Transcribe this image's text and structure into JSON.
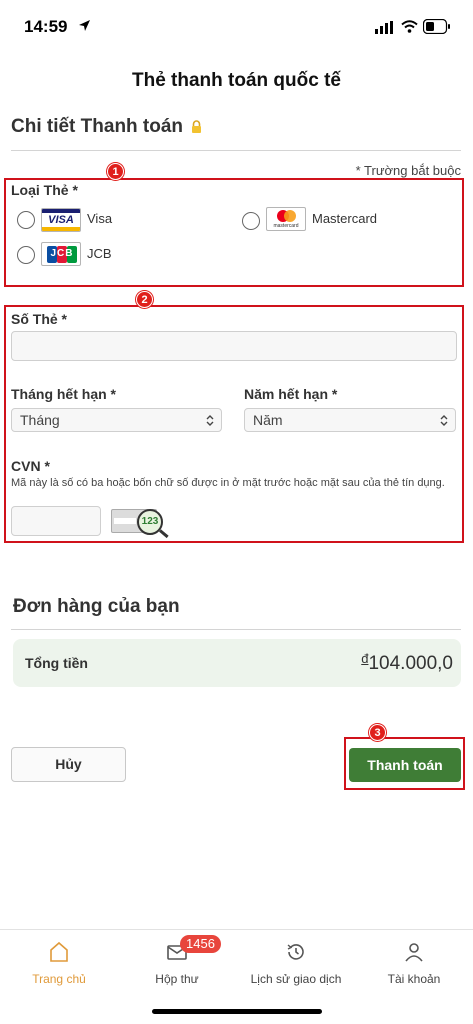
{
  "status_bar": {
    "time": "14:59"
  },
  "header": {
    "title": "Thẻ thanh toán quốc tế"
  },
  "payment": {
    "section_title": "Chi tiết Thanh toán",
    "required_note": "* Trường bắt buộc",
    "card_type_label": "Loại Thẻ *",
    "card_types": [
      {
        "label": "Visa",
        "logo_text": "VISA"
      },
      {
        "label": "Mastercard",
        "logo_text": "mastercard"
      },
      {
        "label": "JCB",
        "logo_text": "JCB"
      }
    ],
    "card_number_label": "Số Thẻ *",
    "card_number_value": "",
    "expiry_month_label": "Tháng hết hạn *",
    "expiry_month_value": "Tháng",
    "expiry_year_label": "Năm hết hạn *",
    "expiry_year_value": "Năm",
    "cvn_label": "CVN *",
    "cvn_help": "Mã này là số có ba hoặc bốn chữ số được in ở mặt trước hoặc mặt sau của thẻ tín dụng.",
    "cvn_value": "",
    "cvn_image_text": "123"
  },
  "annotations": {
    "badge1": "1",
    "badge2": "2",
    "badge3": "3"
  },
  "order": {
    "title": "Đơn hàng của bạn",
    "total_label": "Tổng tiền",
    "currency_symbol": "đ",
    "total_value": "104.000,0"
  },
  "actions": {
    "cancel_label": "Hủy",
    "pay_label": "Thanh toán"
  },
  "bottom_nav": {
    "items": [
      {
        "label": "Trang chủ",
        "icon": "home-icon",
        "active": true
      },
      {
        "label": "Hộp thư",
        "icon": "mail-icon",
        "badge": "1456"
      },
      {
        "label": "Lịch sử giao dịch",
        "icon": "history-icon"
      },
      {
        "label": "Tài khoản",
        "icon": "user-icon"
      }
    ]
  },
  "colors": {
    "accent_green": "#3f7d36",
    "annotation_red": "#d0121b",
    "active_nav": "#e09a3a"
  }
}
